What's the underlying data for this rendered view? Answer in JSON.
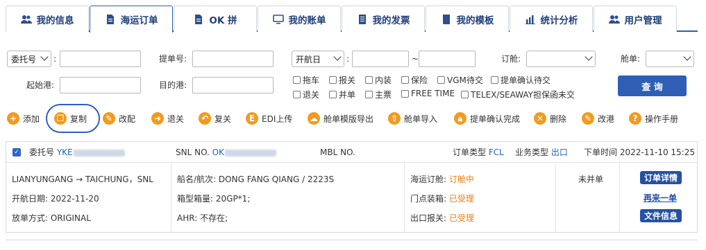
{
  "tabs": [
    {
      "label": "我的信息",
      "icon": "users-icon"
    },
    {
      "label": "海运订单",
      "icon": "document-icon",
      "active": true
    },
    {
      "label": "OK 拼",
      "icon": "document-icon"
    },
    {
      "label": "我的账单",
      "icon": "monitor-icon"
    },
    {
      "label": "我的发票",
      "icon": "invoice-icon"
    },
    {
      "label": "我的模板",
      "icon": "book-icon"
    },
    {
      "label": "统计分析",
      "icon": "bar-chart-icon"
    },
    {
      "label": "用户管理",
      "icon": "users-icon"
    }
  ],
  "filters": {
    "entrust_type": "委托号",
    "bill_no_label": "提单号:",
    "date_type": "开航日",
    "date_sep": "~",
    "booking_label": "订舱:",
    "cabin_label": "舱单:",
    "pol_label": "起始港:",
    "pod_label": "目的港:",
    "colon": ":",
    "checkboxes_row1": [
      "拖车",
      "报关",
      "内装",
      "保险",
      "VGM待交",
      "提单确认待交"
    ],
    "checkboxes_row2": [
      "退关",
      "并单",
      "主票",
      "FREE TIME",
      "TELEX/SEAWAY担保函未交"
    ],
    "query_label": "查 询"
  },
  "toolbar": [
    {
      "label": "添加",
      "icon": "plus-icon"
    },
    {
      "label": "复制",
      "icon": "copy-icon"
    },
    {
      "label": "改配",
      "icon": "edit-icon"
    },
    {
      "label": "退关",
      "icon": "arrow-right-icon"
    },
    {
      "label": "复关",
      "icon": "undo-icon"
    },
    {
      "label": "EDI上传",
      "icon": "edi-icon"
    },
    {
      "label": "舱单模版导出",
      "icon": "cloud-icon"
    },
    {
      "label": "舱单导入",
      "icon": "upload-icon"
    },
    {
      "label": "提单确认完成",
      "icon": "lock-icon"
    },
    {
      "label": "删除",
      "icon": "close-icon"
    },
    {
      "label": "改港",
      "icon": "edit-icon"
    },
    {
      "label": "操作手册",
      "icon": "help-icon"
    }
  ],
  "order": {
    "entrust_label": "委托号",
    "entrust_prefix": "YKE",
    "snl_label": "SNL NO.",
    "snl_prefix": "OK",
    "mbl_label": "MBL NO.",
    "order_type_label": "订单类型",
    "order_type": "FCL",
    "biz_type_label": "业务类型",
    "biz_type": "出口",
    "order_time_label": "下单时间",
    "order_time": "2022-11-10 15:25",
    "route": "LIANYUNGANG → TAICHUNG，SNL",
    "sail_date_label": "开航日期:",
    "sail_date": "2022-11-20",
    "release_label": "放单方式:",
    "release": "ORIGINAL",
    "vessel_label": "船名/航次:",
    "vessel": "DONG FANG QIANG / 2223S",
    "container_label": "箱型箱量:",
    "container": "20GP*1;",
    "ahr_label": "AHR:",
    "ahr": "不存在;",
    "booking_label": "海运订舱:",
    "booking_status": "订舱中",
    "door_label": "门点装箱:",
    "door_status": "已受理",
    "customs_label": "出口报关:",
    "customs_status": "已受理",
    "merge_status": "未并单",
    "detail_btn": "订单详情",
    "again_btn": "再来一单",
    "file_btn": "文件信息"
  }
}
